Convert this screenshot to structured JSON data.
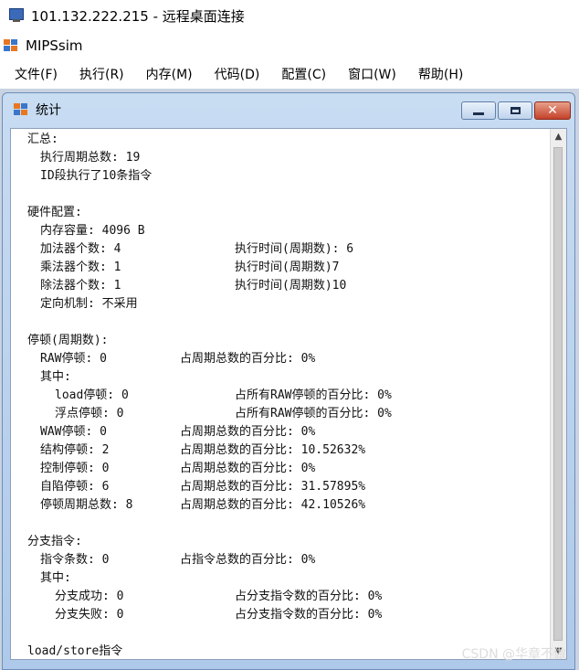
{
  "rdp": {
    "title": "101.132.222.215 - 远程桌面连接"
  },
  "app": {
    "title": "MIPSsim"
  },
  "menu": [
    "文件(F)",
    "执行(R)",
    "内存(M)",
    "代码(D)",
    "配置(C)",
    "窗口(W)",
    "帮助(H)"
  ],
  "child": {
    "title": "统计",
    "btn_min": "minimize",
    "btn_max": "maximize",
    "btn_close": "close"
  },
  "stats": {
    "summary_header": "汇总:",
    "total_cycles": "执行周期总数: 19",
    "id_exec": "ID段执行了10条指令",
    "hw_header": "硬件配置:",
    "mem_size": "内存容量: 4096 B",
    "adder_count": "加法器个数: 4",
    "adder_time": "执行时间(周期数): 6",
    "mul_count": "乘法器个数: 1",
    "mul_time": "执行时间(周期数)7",
    "div_count": "除法器个数: 1",
    "div_time": "执行时间(周期数)10",
    "forwarding": "定向机制: 不采用",
    "stall_header": "停顿(周期数):",
    "raw": "RAW停顿: 0",
    "raw_pct": "占周期总数的百分比: 0%",
    "among1": "其中:",
    "load": "load停顿: 0",
    "load_pct": "占所有RAW停顿的百分比: 0%",
    "float": "浮点停顿: 0",
    "float_pct": "占所有RAW停顿的百分比: 0%",
    "waw": "WAW停顿: 0",
    "waw_pct": "占周期总数的百分比: 0%",
    "struct": "结构停顿: 2",
    "struct_pct": "占周期总数的百分比: 10.52632%",
    "control": "控制停顿: 0",
    "control_pct": "占周期总数的百分比: 0%",
    "trap": "自陷停顿: 6",
    "trap_pct": "占周期总数的百分比: 31.57895%",
    "stall_total": "停顿周期总数: 8",
    "stall_total_pct": "占周期总数的百分比: 42.10526%",
    "branch_header": "分支指令:",
    "branch_count": "指令条数: 0",
    "branch_pct": "占指令总数的百分比: 0%",
    "among2": "其中:",
    "branch_ok": "分支成功: 0",
    "branch_ok_pct": "占分支指令数的百分比: 0%",
    "branch_fail": "分支失败: 0",
    "branch_fail_pct": "占分支指令数的百分比: 0%",
    "ls_header_partial": "load/store指令"
  },
  "watermark": "CSDN @华章不做"
}
